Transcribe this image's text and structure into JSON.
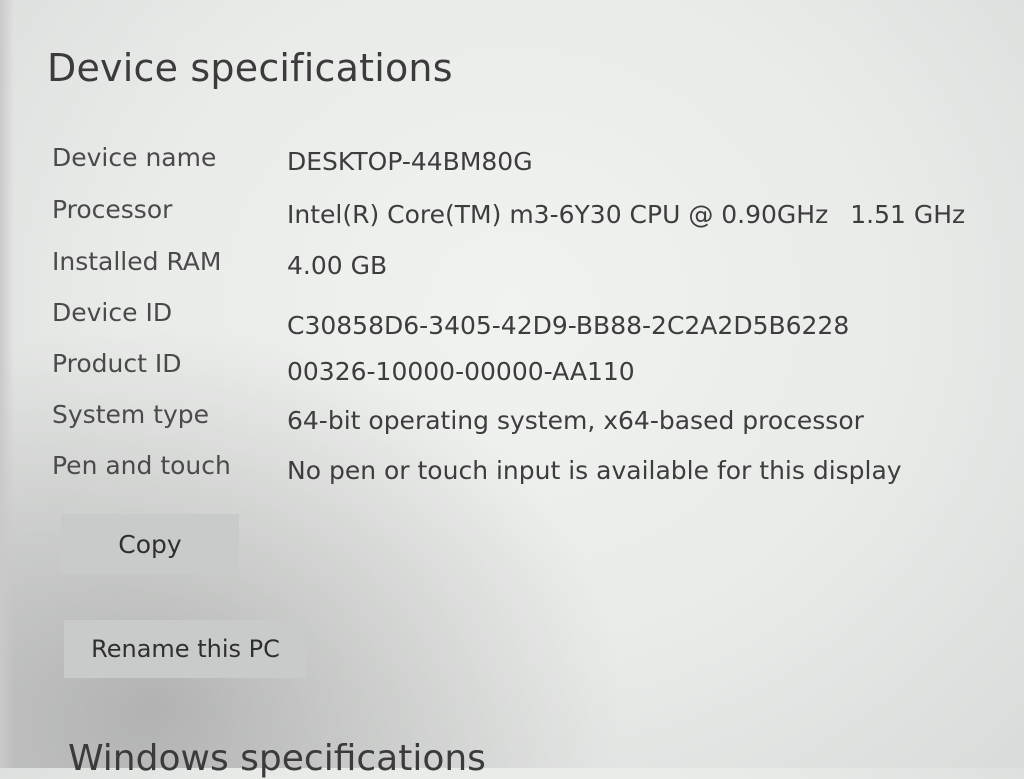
{
  "device_specs": {
    "title": "Device specifications",
    "rows": [
      {
        "label": "Device name",
        "value": "DESKTOP-44BM80G"
      },
      {
        "label": "Processor",
        "value": "Intel(R) Core(TM) m3-6Y30 CPU @ 0.90GHz",
        "value_extra": "1.51 GHz"
      },
      {
        "label": "Installed RAM",
        "value": "4.00 GB"
      },
      {
        "label": "Device ID",
        "value": "C30858D6-3405-42D9-BB88-2C2A2D5B6228"
      },
      {
        "label": "Product ID",
        "value": "00326-10000-00000-AA110"
      },
      {
        "label": "System type",
        "value": "64-bit operating system, x64-based processor"
      },
      {
        "label": "Pen and touch",
        "value": "No pen or touch input is available for this display"
      }
    ],
    "copy_label": "Copy",
    "rename_label": "Rename this PC"
  },
  "windows_specs": {
    "title": "Windows specifications"
  }
}
